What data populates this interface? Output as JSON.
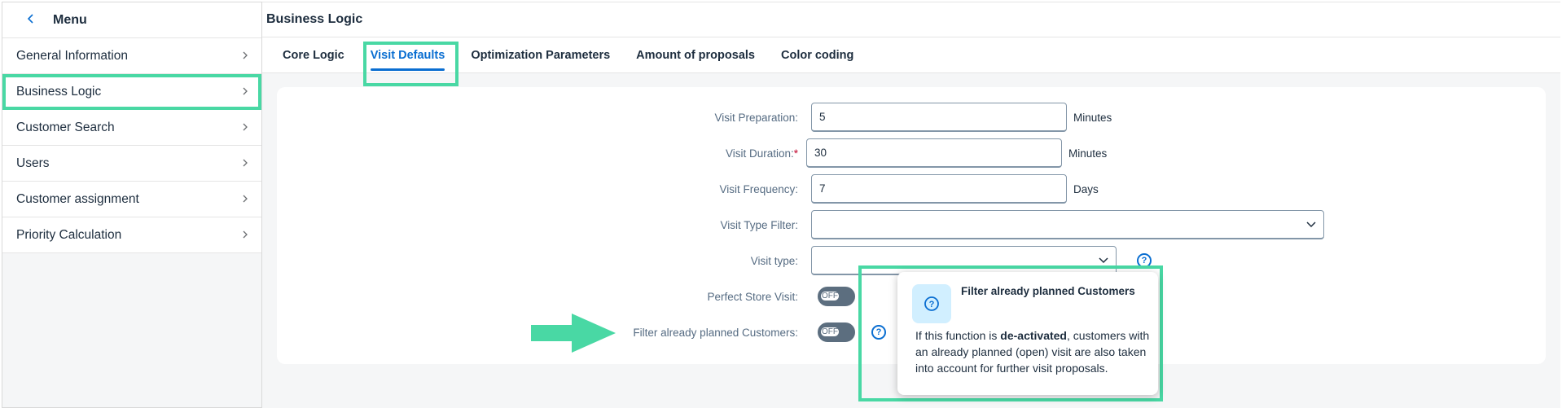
{
  "sidebar": {
    "title": "Menu",
    "items": [
      {
        "label": "General Information"
      },
      {
        "label": "Business Logic"
      },
      {
        "label": "Customer Search"
      },
      {
        "label": "Users"
      },
      {
        "label": "Customer assignment"
      },
      {
        "label": "Priority Calculation"
      }
    ],
    "selected_index": 1
  },
  "main": {
    "title": "Business Logic",
    "tabs": [
      {
        "label": "Core Logic"
      },
      {
        "label": "Visit Defaults"
      },
      {
        "label": "Optimization Parameters"
      },
      {
        "label": "Amount of proposals"
      },
      {
        "label": "Color coding"
      }
    ],
    "active_tab_index": 1
  },
  "form": {
    "visit_preparation": {
      "label": "Visit Preparation:",
      "value": "5",
      "unit": "Minutes"
    },
    "visit_duration": {
      "label": "Visit Duration:",
      "required_mark": "*",
      "value": "30",
      "unit": "Minutes"
    },
    "visit_frequency": {
      "label": "Visit Frequency:",
      "value": "7",
      "unit": "Days"
    },
    "visit_type_filter": {
      "label": "Visit Type Filter:",
      "value": ""
    },
    "visit_type": {
      "label": "Visit type:",
      "value": ""
    },
    "perfect_store_visit": {
      "label": "Perfect Store Visit:",
      "state": "OFF"
    },
    "filter_planned": {
      "label": "Filter already planned Customers:",
      "state": "OFF"
    }
  },
  "popover": {
    "title": "Filter already planned Customers",
    "body_prefix": "If this function is ",
    "body_bold": "de-activated",
    "body_suffix": ", customers with an already planned (open) visit are also taken into account for further visit proposals."
  },
  "icons": {
    "back": "chevron-left-icon",
    "chevron": "chevron-right-icon",
    "dropdown": "chevron-down-icon",
    "help": "question-circle-icon"
  },
  "colors": {
    "highlight": "#49d8a4",
    "accent": "#0a6ed1",
    "required": "#c0032b",
    "toggle_off": "#5c6e7f"
  }
}
